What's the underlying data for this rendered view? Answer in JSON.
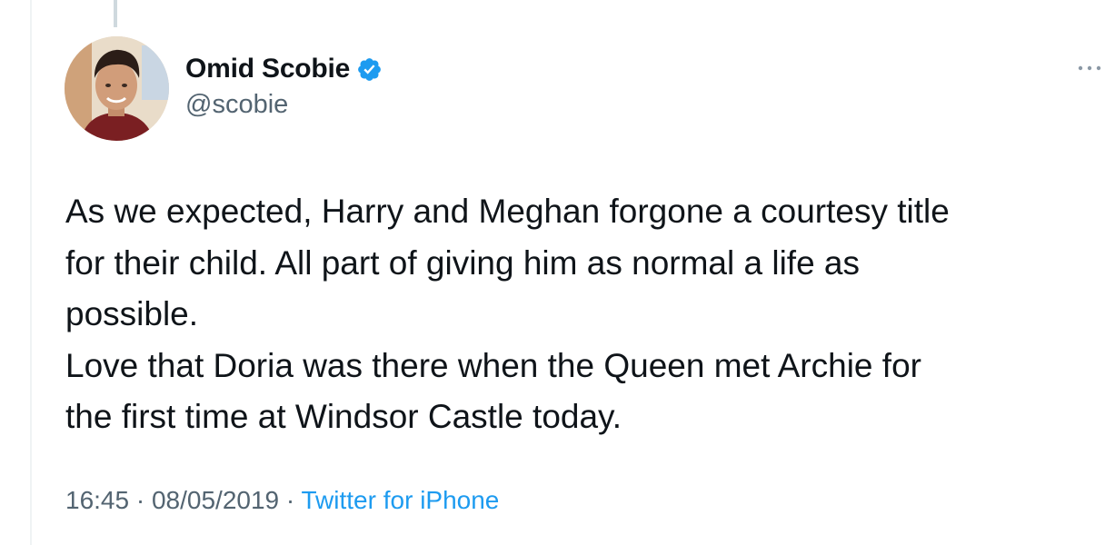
{
  "tweet": {
    "author": {
      "display_name": "Omid Scobie",
      "handle": "@scobie",
      "verified": true,
      "avatar_icon": "profile-photo-icon"
    },
    "more_icon": "more-options-icon",
    "text_lines": [
      "As we expected, Harry and Meghan forgone a courtesy title",
      "for their child. All part of giving him as normal a life as",
      "possible.",
      "Love that Doria was there when the Queen met Archie for",
      "the first time at Windsor Castle today."
    ],
    "time": "16:45",
    "date": "08/05/2019",
    "separator": "·",
    "source": "Twitter for iPhone"
  },
  "colors": {
    "primary_text": "#0f1419",
    "secondary_text": "#536471",
    "accent": "#1d9bf0",
    "verified_badge": "#1d9bf0"
  }
}
